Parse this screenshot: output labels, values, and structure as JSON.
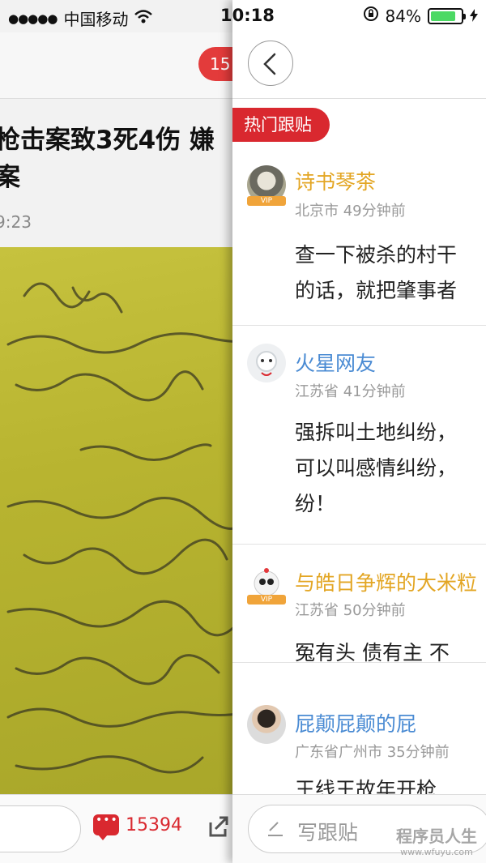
{
  "status_bar": {
    "signal_dots": "●●●●●",
    "carrier": "中国移动",
    "time": "10:18",
    "battery_text": "84%",
    "battery_level_percent": 84
  },
  "background_article": {
    "comment_badge": "15",
    "title_line1": "枪击案致3死4伤 嫌",
    "title_line2": "案",
    "time": "9:23",
    "comment_count": "15394",
    "colors": {
      "accent": "#d9282f"
    }
  },
  "panel": {
    "section_tag": "热门跟贴",
    "comments": [
      {
        "name": "诗书琴茶",
        "vip": "VIP",
        "name_color": "gold",
        "location": "北京市",
        "time_ago": "49分钟前",
        "body": [
          "查一下被杀的村干",
          "的话，就把肇事者"
        ]
      },
      {
        "name": "火星网友",
        "name_color": "blue",
        "location": "江苏省",
        "time_ago": "41分钟前",
        "body": [
          "强拆叫土地纠纷，",
          "可以叫感情纠纷，",
          "纷！"
        ]
      },
      {
        "name": "与皓日争辉的大米粒",
        "vip": "VIP",
        "name_color": "gold",
        "location": "江苏省",
        "time_ago": "50分钟前",
        "body": [
          "冤有头 债有主 不"
        ]
      },
      {
        "name": "屁颠屁颠的屁",
        "name_color": "blue",
        "location": "广东省广州市",
        "time_ago": "35分钟前",
        "body": [
          "王线王故年开枪"
        ]
      }
    ],
    "write_placeholder": "写跟贴"
  },
  "watermark": {
    "line1": "程序员人生",
    "line2": "www.wfuyu.com"
  },
  "icons": {
    "back": "chevron-left-icon",
    "comment": "comment-bubble-icon",
    "share": "share-icon",
    "pencil": "pencil-icon",
    "wifi": "wifi-icon",
    "lock": "orientation-lock-icon",
    "battery": "battery-icon",
    "charging": "charging-bolt-icon"
  }
}
